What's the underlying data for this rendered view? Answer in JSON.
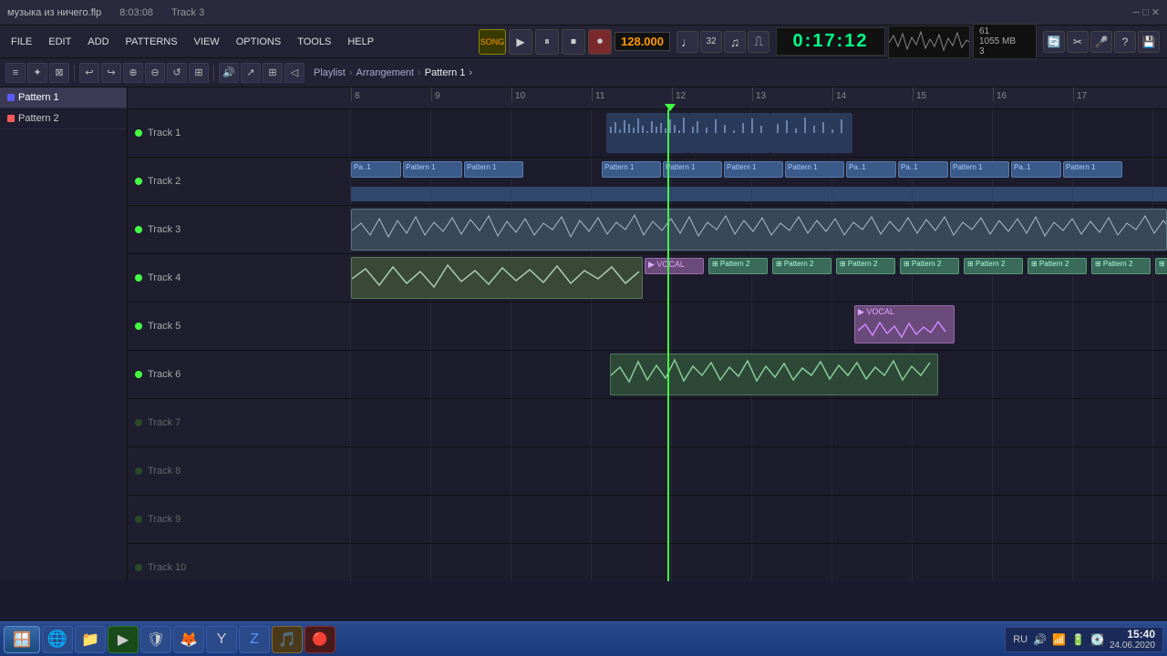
{
  "titleBar": {
    "project": "музыка из ничего.flp",
    "time": "8:03:08",
    "track": "Track 3"
  },
  "menuBar": {
    "items": [
      "FILE",
      "EDIT",
      "ADD",
      "PATTERNS",
      "VIEW",
      "OPTIONS",
      "TOOLS",
      "HELP"
    ]
  },
  "transport": {
    "bpm": "128.000",
    "timeDisplay": "0:17:12",
    "patternName": "Pattern 1",
    "cpuLine1": "61",
    "cpuLine2": "1055 MB",
    "cpuLine3": "3"
  },
  "breadcrumb": {
    "parts": [
      "Playlist",
      "Arrangement",
      "Pattern 1"
    ]
  },
  "patterns": [
    {
      "name": "Pattern 1",
      "active": true
    },
    {
      "name": "Pattern 2",
      "active": false
    }
  ],
  "ruler": {
    "marks": [
      "9",
      "10",
      "11",
      "12",
      "13",
      "14",
      "15",
      "16",
      "17"
    ]
  },
  "tracks": [
    {
      "label": "Track 1",
      "hasContent": true,
      "type": "midi"
    },
    {
      "label": "Track 2",
      "hasContent": true,
      "type": "pattern"
    },
    {
      "label": "Track 3",
      "hasContent": true,
      "type": "audio"
    },
    {
      "label": "Track 4",
      "hasContent": true,
      "type": "mixed"
    },
    {
      "label": "Track 5",
      "hasContent": true,
      "type": "vocal"
    },
    {
      "label": "Track 6",
      "hasContent": true,
      "type": "audio"
    },
    {
      "label": "Track 7",
      "hasContent": false,
      "type": "empty"
    },
    {
      "label": "Track 8",
      "hasContent": false,
      "type": "empty"
    },
    {
      "label": "Track 9",
      "hasContent": false,
      "type": "empty"
    },
    {
      "label": "Track 10",
      "hasContent": false,
      "type": "empty"
    }
  ],
  "taskbar": {
    "time": "15:40",
    "date": "24.06.2020",
    "lang": "RU",
    "apps": [
      {
        "icon": "🪟",
        "name": "start"
      },
      {
        "icon": "🌐",
        "name": "ie"
      },
      {
        "icon": "📁",
        "name": "explorer"
      },
      {
        "icon": "▶",
        "name": "media"
      },
      {
        "icon": "🔴",
        "name": "antivirus1"
      },
      {
        "icon": "🦊",
        "name": "firefox"
      },
      {
        "icon": "🌀",
        "name": "yandex"
      },
      {
        "icon": "💙",
        "name": "downloader"
      },
      {
        "icon": "🟠",
        "name": "fl-studio"
      },
      {
        "icon": "🔴",
        "name": "antivirus2"
      }
    ]
  }
}
